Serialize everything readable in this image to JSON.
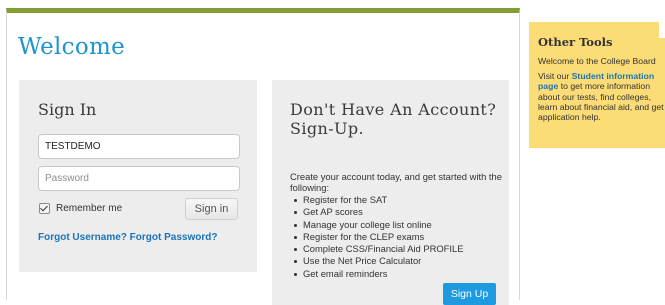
{
  "welcome": {
    "title": "Welcome"
  },
  "sign_in": {
    "heading": "Sign In",
    "username_value": "TESTDEMO",
    "password_placeholder": "Password",
    "remember_label": "Remember me",
    "remember_checked": true,
    "button_label": "Sign in",
    "forgot_link": "Forgot Username? Forgot Password?"
  },
  "sign_up": {
    "heading": "Don't Have An Account? Sign-Up.",
    "intro": "Create your account today, and get started with the following:",
    "benefits": [
      "Register for the SAT",
      "Get AP scores",
      "Manage your college list online",
      "Register for the CLEP exams",
      "Complete CSS/Financial Aid PROFILE",
      "Use the Net Price Calculator",
      "Get email reminders"
    ],
    "button_label": "Sign Up"
  },
  "other_tools": {
    "title": "Other Tools",
    "welcome_text": "Welcome to the College Board",
    "visit_prefix": "Visit our ",
    "link_text": "Student information page",
    "visit_suffix": " to get more information about our tests, find colleges, learn about financial aid, and get application help."
  },
  "colors": {
    "top_bar": "#829e34",
    "accent_blue": "#1f94cc",
    "link_blue": "#1a74b8",
    "signup_button": "#1e9be0",
    "tools_background": "#fbdc76",
    "panel_background": "#ededed"
  }
}
